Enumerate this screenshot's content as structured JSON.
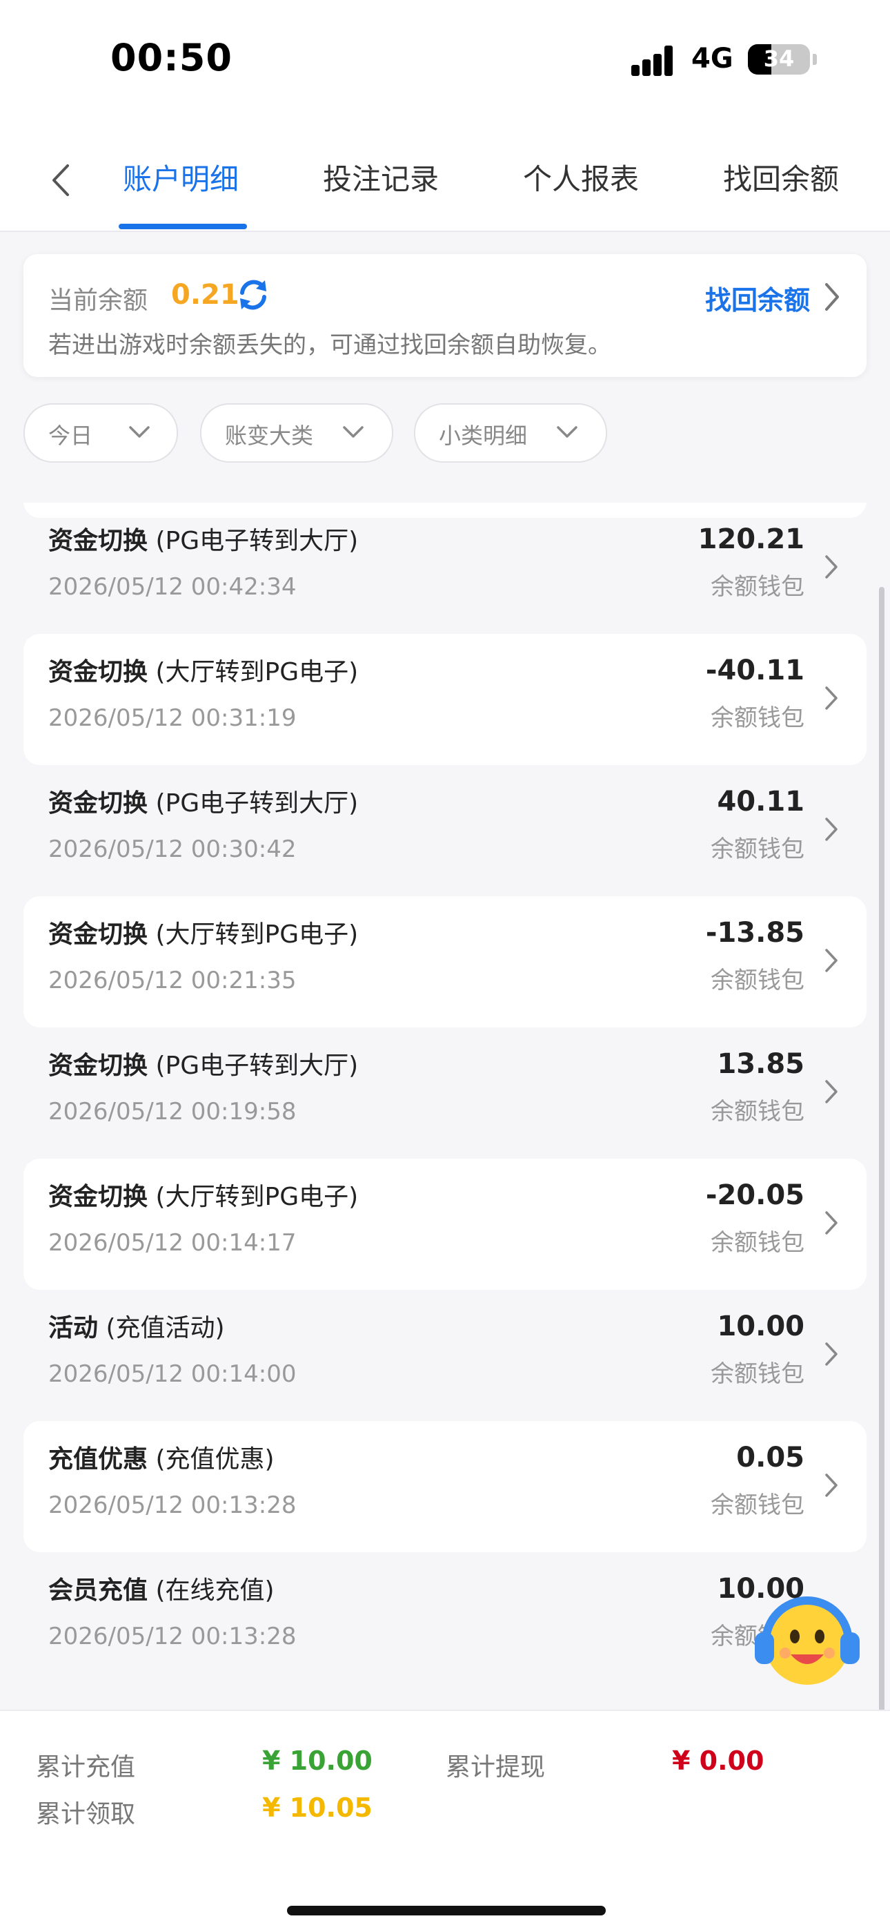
{
  "status_bar": {
    "time": "00:50",
    "network": "4G",
    "battery": "34"
  },
  "tabs": [
    {
      "label": "账户明细",
      "active": true
    },
    {
      "label": "投注记录",
      "active": false
    },
    {
      "label": "个人报表",
      "active": false
    },
    {
      "label": "找回余额",
      "active": false
    }
  ],
  "balance": {
    "label": "当前余额",
    "value": "0.21",
    "recover_link": "找回余额",
    "hint": "若进出游戏时余额丢失的，可通过找回余额自助恢复。"
  },
  "filters": [
    {
      "label": "今日"
    },
    {
      "label": "账变大类"
    },
    {
      "label": "小类明细"
    }
  ],
  "transactions": [
    {
      "type": "资金切换",
      "detail": "(PG电子转到大厅)",
      "time": "2026/05/12 00:42:34",
      "amount": "120.21",
      "wallet": "余额钱包"
    },
    {
      "type": "资金切换",
      "detail": "(大厅转到PG电子)",
      "time": "2026/05/12 00:31:19",
      "amount": "-40.11",
      "wallet": "余额钱包"
    },
    {
      "type": "资金切换",
      "detail": "(PG电子转到大厅)",
      "time": "2026/05/12 00:30:42",
      "amount": "40.11",
      "wallet": "余额钱包"
    },
    {
      "type": "资金切换",
      "detail": "(大厅转到PG电子)",
      "time": "2026/05/12 00:21:35",
      "amount": "-13.85",
      "wallet": "余额钱包"
    },
    {
      "type": "资金切换",
      "detail": "(PG电子转到大厅)",
      "time": "2026/05/12 00:19:58",
      "amount": "13.85",
      "wallet": "余额钱包"
    },
    {
      "type": "资金切换",
      "detail": "(大厅转到PG电子)",
      "time": "2026/05/12 00:14:17",
      "amount": "-20.05",
      "wallet": "余额钱包"
    },
    {
      "type": "活动",
      "detail": "(充值活动)",
      "time": "2026/05/12 00:14:00",
      "amount": "10.00",
      "wallet": "余额钱包"
    },
    {
      "type": "充值优惠",
      "detail": "(充值优惠)",
      "time": "2026/05/12 00:13:28",
      "amount": "0.05",
      "wallet": "余额钱包"
    },
    {
      "type": "会员充值",
      "detail": "(在线充值)",
      "time": "2026/05/12 00:13:28",
      "amount": "10.00",
      "wallet": "余额钱包"
    }
  ],
  "summary": {
    "recharge_label": "累计充值",
    "recharge_value": "¥ 10.00",
    "withdraw_label": "累计提现",
    "withdraw_value": "¥ 0.00",
    "claim_label": "累计领取",
    "claim_value": "¥ 10.05"
  },
  "colors": {
    "accent": "#1a73e8",
    "balance": "#f5a623",
    "recharge": "#3aa335",
    "withdraw": "#d0021b",
    "claim": "#f5b800"
  }
}
